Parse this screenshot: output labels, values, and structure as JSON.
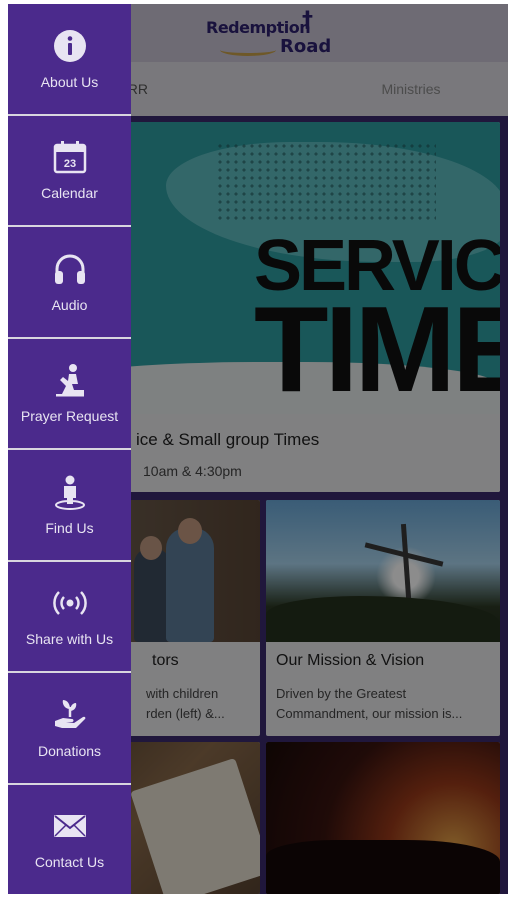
{
  "header": {
    "logo_line1": "Redemption",
    "logo_line2": "Road",
    "logo_cross": "†"
  },
  "tabs": [
    {
      "label": "t RR"
    },
    {
      "label": "Ministries"
    }
  ],
  "feature": {
    "image_text_1": "SERVICE",
    "image_text_2": "TIME",
    "title": "ice & Small group Times",
    "subtitle": "10am & 4:30pm"
  },
  "cards": [
    {
      "title": "tors",
      "desc_line1": "with children",
      "desc_line2": "rden (left) &..."
    },
    {
      "title": "Our Mission & Vision",
      "desc_line1": "Driven by the Greatest",
      "desc_line2": "Commandment, our mission is..."
    },
    {
      "title": "",
      "desc_line1": "",
      "desc_line2": ""
    },
    {
      "title": "",
      "desc_line1": "",
      "desc_line2": ""
    }
  ],
  "drawer": {
    "items": [
      {
        "label": "About Us",
        "icon": "info-icon"
      },
      {
        "label": "Calendar",
        "icon": "calendar-icon",
        "calendar_day": "23"
      },
      {
        "label": "Audio",
        "icon": "headphones-icon"
      },
      {
        "label": "Prayer Request",
        "icon": "praying-person-icon"
      },
      {
        "label": "Find Us",
        "icon": "person-location-icon"
      },
      {
        "label": "Share with Us",
        "icon": "broadcast-icon"
      },
      {
        "label": "Donations",
        "icon": "hand-plant-icon"
      },
      {
        "label": "Contact Us",
        "icon": "envelope-icon"
      }
    ]
  },
  "colors": {
    "drawer_bg": "#4b2a8c",
    "app_bg": "#3b2b6e",
    "logo": "#2e2170"
  }
}
